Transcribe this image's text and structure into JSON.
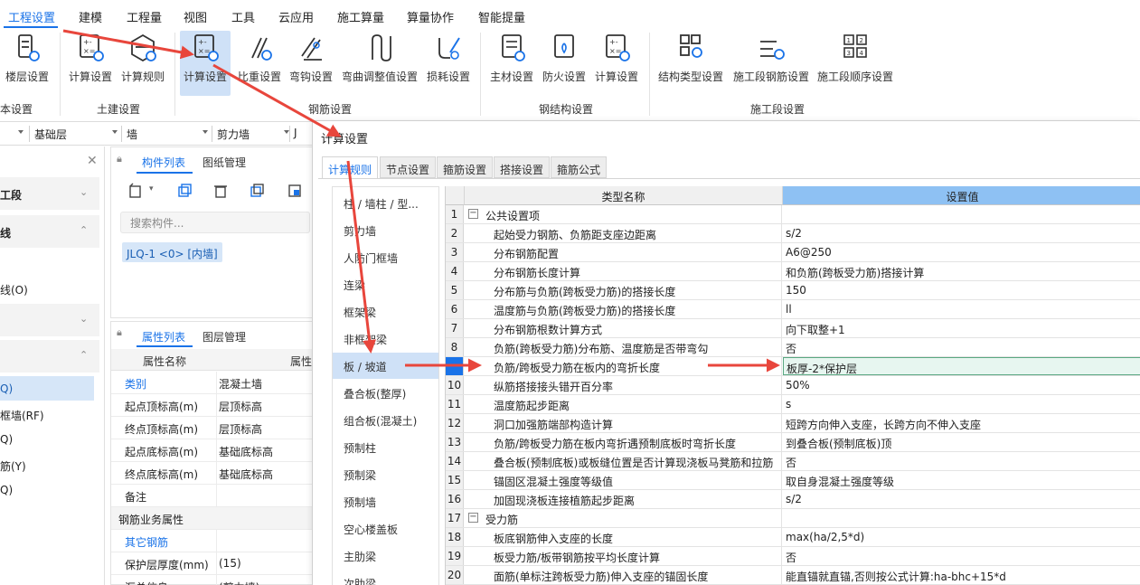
{
  "menu": [
    "工程设置",
    "建模",
    "工程量",
    "视图",
    "工具",
    "云应用",
    "施工算量",
    "算量协作",
    "智能提量"
  ],
  "menu_active": 0,
  "ribbon": {
    "buttons": [
      {
        "label": "楼层设置",
        "icon": "floor-settings-icon"
      },
      {
        "label": "计算设置",
        "icon": "calc-settings-icon"
      },
      {
        "label": "计算规则",
        "icon": "calc-rules-icon"
      },
      {
        "label": "计算设置",
        "icon": "rebar-calc-settings-icon"
      },
      {
        "label": "比重设置",
        "icon": "density-settings-icon"
      },
      {
        "label": "弯钩设置",
        "icon": "hook-settings-icon"
      },
      {
        "label": "弯曲调整值设置",
        "icon": "bend-adjust-icon"
      },
      {
        "label": "损耗设置",
        "icon": "loss-settings-icon"
      },
      {
        "label": "主材设置",
        "icon": "main-material-icon"
      },
      {
        "label": "防火设置",
        "icon": "fireproof-icon"
      },
      {
        "label": "计算设置",
        "icon": "steel-calc-settings-icon"
      },
      {
        "label": "结构类型设置",
        "icon": "structure-type-icon"
      },
      {
        "label": "施工段钢筋设置",
        "icon": "segment-rebar-icon"
      },
      {
        "label": "施工段顺序设置",
        "icon": "segment-order-icon"
      }
    ],
    "groups": [
      "本设置",
      "土建设置",
      "钢筋设置",
      "钢结构设置",
      "施工段设置"
    ]
  },
  "filterbar": [
    "基础层",
    "墙",
    "剪力墙",
    "J"
  ],
  "leftnav": {
    "headers": [
      "工段",
      "线"
    ],
    "items": [
      "线(O)",
      "Q)",
      "框墙(RF)",
      "Q)",
      "筋(Y)",
      "Q)"
    ]
  },
  "parts_panel": {
    "tabs": [
      "构件列表",
      "图纸管理"
    ],
    "search_placeholder": "搜索构件...",
    "tag": "JLQ-1 <0> [内墙]"
  },
  "props_panel": {
    "tabs": [
      "属性列表",
      "图层管理"
    ],
    "col_name": "属性名称",
    "col_value": "属性",
    "rows": [
      {
        "k": "类别",
        "v": "混凝土墙",
        "link": true
      },
      {
        "k": "起点顶标高(m)",
        "v": "层顶标高"
      },
      {
        "k": "终点顶标高(m)",
        "v": "层顶标高"
      },
      {
        "k": "起点底标高(m)",
        "v": "基础底标高"
      },
      {
        "k": "终点底标高(m)",
        "v": "基础底标高"
      },
      {
        "k": "备注",
        "v": ""
      },
      {
        "k": "钢筋业务属性",
        "v": "",
        "section": true
      },
      {
        "k": "其它钢筋",
        "v": "",
        "link": true
      },
      {
        "k": "保护层厚度(mm)",
        "v": "(15)"
      },
      {
        "k": "汇总信息",
        "v": "(剪力墙)"
      }
    ]
  },
  "dialog": {
    "title": "计算设置",
    "tabs": [
      "计算规则",
      "节点设置",
      "箍筋设置",
      "搭接设置",
      "箍筋公式"
    ],
    "categories": [
      "柱 / 墙柱 / 型...",
      "剪力墙",
      "人防门框墙",
      "连梁",
      "框架梁",
      "非框架梁",
      "板 / 坡道",
      "叠合板(整厚)",
      "组合板(混凝土)",
      "预制柱",
      "预制梁",
      "预制墙",
      "空心楼盖板",
      "主肋梁",
      "次肋梁"
    ],
    "selected_category": 6,
    "grid": {
      "col_name": "类型名称",
      "col_value": "设置值",
      "rows": [
        {
          "n": "1",
          "name": "公共设置项",
          "val": "",
          "group": true
        },
        {
          "n": "2",
          "name": "起始受力钢筋、负筋距支座边距离",
          "val": "s/2"
        },
        {
          "n": "3",
          "name": "分布钢筋配置",
          "val": "A6@250"
        },
        {
          "n": "4",
          "name": "分布钢筋长度计算",
          "val": "和负筋(跨板受力筋)搭接计算"
        },
        {
          "n": "5",
          "name": "分布筋与负筋(跨板受力筋)的搭接长度",
          "val": "150"
        },
        {
          "n": "6",
          "name": "温度筋与负筋(跨板受力筋)的搭接长度",
          "val": "ll"
        },
        {
          "n": "7",
          "name": "分布钢筋根数计算方式",
          "val": "向下取整+1"
        },
        {
          "n": "8",
          "name": "负筋(跨板受力筋)分布筋、温度筋是否带弯勾",
          "val": "否"
        },
        {
          "n": "9",
          "name": "负筋/跨板受力筋在板内的弯折长度",
          "val": "板厚-2*保护层",
          "current": true
        },
        {
          "n": "10",
          "name": "纵筋搭接接头错开百分率",
          "val": "50%"
        },
        {
          "n": "11",
          "name": "温度筋起步距离",
          "val": "s"
        },
        {
          "n": "12",
          "name": "洞口加强筋端部构造计算",
          "val": "短跨方向伸入支座，长跨方向不伸入支座"
        },
        {
          "n": "13",
          "name": "负筋/跨板受力筋在板内弯折遇预制底板时弯折长度",
          "val": "到叠合板(预制底板)顶"
        },
        {
          "n": "14",
          "name": "叠合板(预制底板)或板缝位置是否计算现浇板马凳筋和拉筋",
          "val": "否"
        },
        {
          "n": "15",
          "name": "锚固区混凝土强度等级值",
          "val": "取自身混凝土强度等级"
        },
        {
          "n": "16",
          "name": "加固现浇板连接植筋起步距离",
          "val": "s/2"
        },
        {
          "n": "17",
          "name": "受力筋",
          "val": "",
          "group": true
        },
        {
          "n": "18",
          "name": "板底钢筋伸入支座的长度",
          "val": "max(ha/2,5*d)"
        },
        {
          "n": "19",
          "name": "板受力筋/板带钢筋按平均长度计算",
          "val": "否"
        },
        {
          "n": "20",
          "name": "面筋(单标注跨板受力筋)伸入支座的锚固长度",
          "val": "能直锚就直锚,否则按公式计算:ha-bhc+15*d"
        }
      ]
    }
  },
  "colors": {
    "accent": "#1a73e8",
    "arrow": "#e8463c",
    "selected": "#cfe1f7"
  }
}
